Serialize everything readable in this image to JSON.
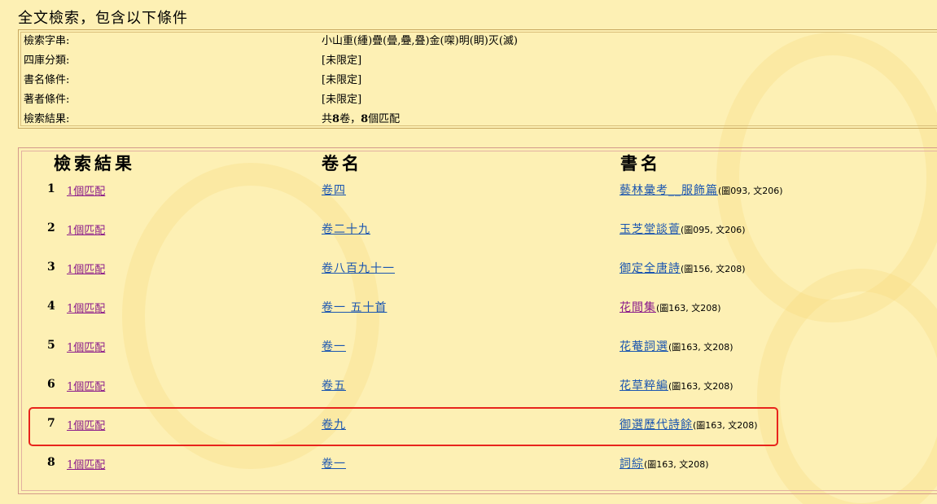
{
  "heading": "全文檢索，包含以下條件",
  "criteria": [
    {
      "label": "檢索字串:",
      "value": "小山重(緟)疊(曡,疉,疂)金(㗎)明(眀)灭(滅)"
    },
    {
      "label": "四庫分類:",
      "value": "[未限定]"
    },
    {
      "label": "書名條件:",
      "value": "[未限定]"
    },
    {
      "label": "著者條件:",
      "value": "[未限定]"
    }
  ],
  "result_summary": {
    "label": "檢索結果:",
    "prefix": "共",
    "juan_count": "8",
    "middle": "卷，",
    "match_count": "8",
    "suffix": "個匹配"
  },
  "columns": {
    "results": "檢索結果",
    "juan": "卷名",
    "book": "書名"
  },
  "rows": [
    {
      "num": "1",
      "match": "1個匹配",
      "juan": "卷四",
      "book": "藝林彙考__服飾篇",
      "meta": "(圖093, 文206)",
      "book_visited": false
    },
    {
      "num": "2",
      "match": "1個匹配",
      "juan": "卷二十九",
      "book": "玉芝堂談薈",
      "meta": "(圖095, 文206)",
      "book_visited": false
    },
    {
      "num": "3",
      "match": "1個匹配",
      "juan": "卷八百九十一",
      "book": "御定全唐詩",
      "meta": "(圖156, 文208)",
      "book_visited": false
    },
    {
      "num": "4",
      "match": "1個匹配",
      "juan": "卷一 五十首",
      "book": "花間集",
      "meta": "(圖163, 文208)",
      "book_visited": true
    },
    {
      "num": "5",
      "match": "1個匹配",
      "juan": "卷一",
      "book": "花菴詞選",
      "meta": "(圖163, 文208)",
      "book_visited": false
    },
    {
      "num": "6",
      "match": "1個匹配",
      "juan": "卷五",
      "book": "花草粹編",
      "meta": "(圖163, 文208)",
      "book_visited": false
    },
    {
      "num": "7",
      "match": "1個匹配",
      "juan": "卷九",
      "book": "御選歷代詩餘",
      "meta": "(圖163, 文208)",
      "book_visited": false
    },
    {
      "num": "8",
      "match": "1個匹配",
      "juan": "卷一",
      "book": "詞綜",
      "meta": "(圖163, 文208)",
      "book_visited": false
    }
  ],
  "colors": {
    "background": "#fdf0b4",
    "link": "#1a55b0",
    "visited_link": "#8a1a8a",
    "highlight": "#e8241c"
  }
}
